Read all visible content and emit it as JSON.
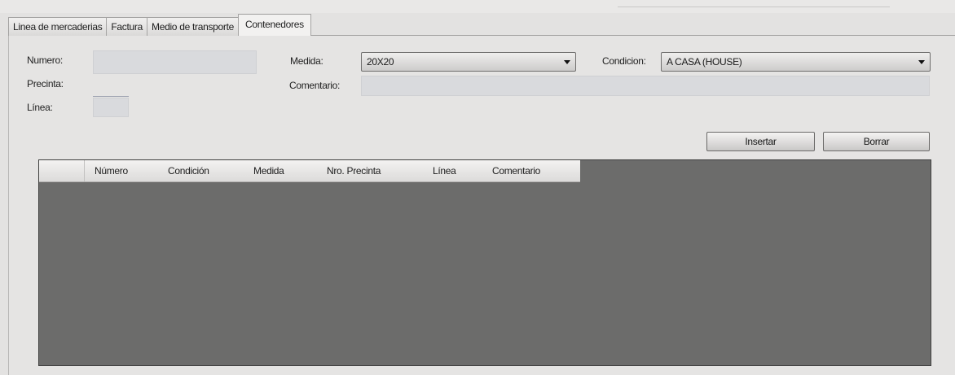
{
  "tabs": [
    {
      "label": "Linea de mercaderias",
      "active": false
    },
    {
      "label": "Factura",
      "active": false
    },
    {
      "label": "Medio de transporte",
      "active": false
    },
    {
      "label": "Contenedores",
      "active": true
    }
  ],
  "form": {
    "numero_label": "Numero:",
    "numero_value": "",
    "precinta_label": "Precinta:",
    "precinta_value": "",
    "linea_label": "Línea:",
    "linea_value": "",
    "medida_label": "Medida:",
    "medida_value": "20X20",
    "condicion_label": "Condicion:",
    "condicion_value": "A CASA (HOUSE)",
    "comentario_label": "Comentario:",
    "comentario_value": ""
  },
  "buttons": {
    "insertar": "Insertar",
    "borrar": "Borrar"
  },
  "grid": {
    "columns": [
      "Número",
      "Condición",
      "Medida",
      "Nro. Precinta",
      "Línea",
      "Comentario"
    ],
    "rows": []
  },
  "colors": {
    "grid_background": "#6c6c6b",
    "window_background": "#e3e2e1"
  }
}
